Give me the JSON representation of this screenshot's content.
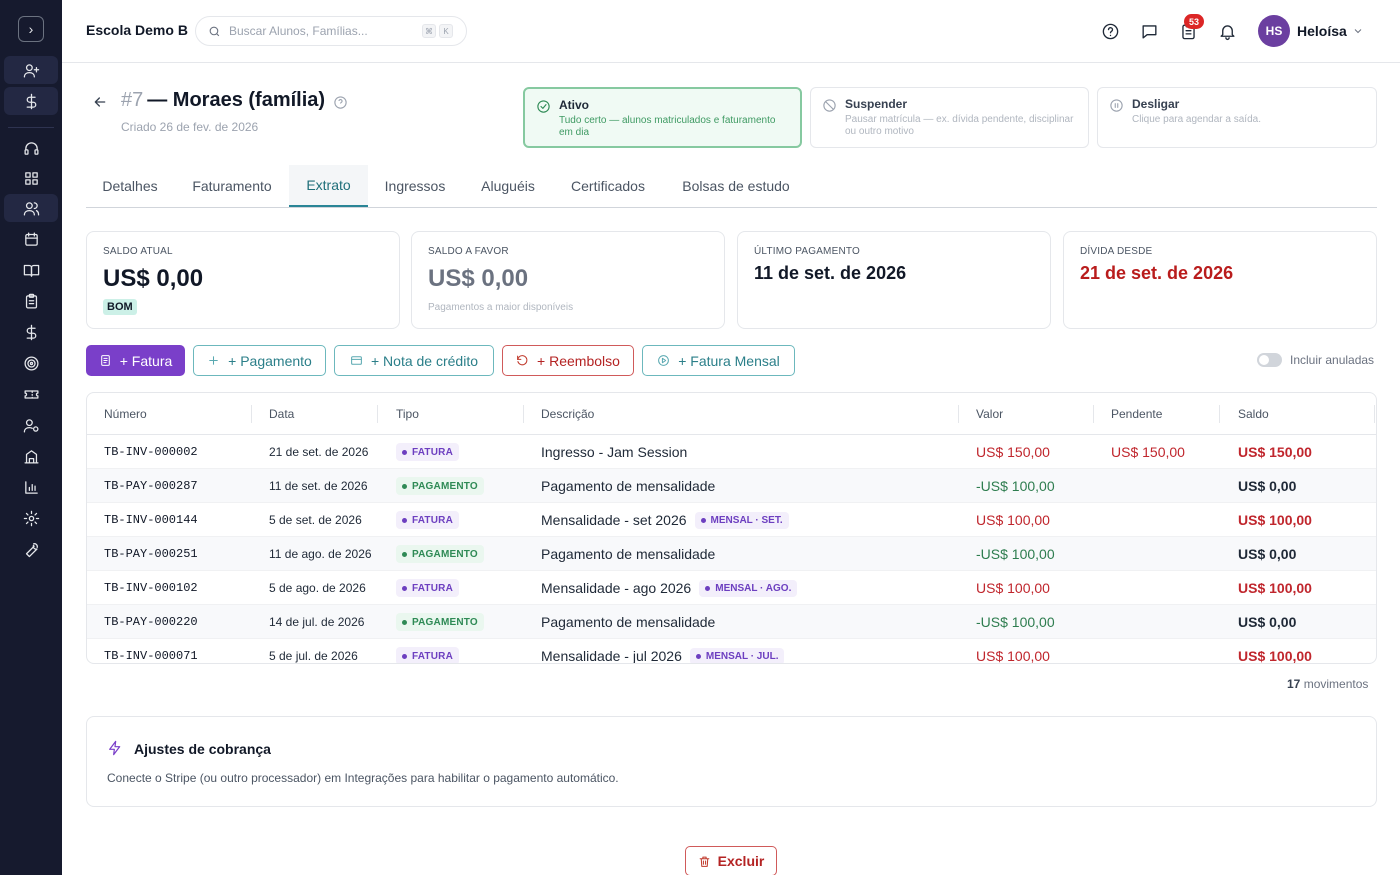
{
  "header": {
    "school": "Escola Demo B",
    "search_placeholder": "Buscar Alunos, Famílias...",
    "shortcut": [
      "⌘",
      "K"
    ],
    "notification_count": "53",
    "user_initials": "HS",
    "user_name": "Heloísa"
  },
  "page": {
    "id": "#7",
    "title": "— Moraes (família)",
    "created": "Criado 26 de fev. de 2026"
  },
  "status_cards": [
    {
      "title": "Ativo",
      "desc": "Tudo certo — alunos matriculados e faturamento em dia",
      "icon": "check-circle-icon"
    },
    {
      "title": "Suspender",
      "desc": "Pausar matrícula — ex. dívida pendente, disciplinar ou outro motivo",
      "icon": "ban-icon"
    },
    {
      "title": "Desligar",
      "desc": "Clique para agendar a saída.",
      "icon": "pause-circle-icon"
    }
  ],
  "tabs": [
    "Detalhes",
    "Faturamento",
    "Extrato",
    "Ingressos",
    "Aluguéis",
    "Certificados",
    "Bolsas de estudo"
  ],
  "active_tab": "Extrato",
  "summary": {
    "saldo_atual_label": "SALDO ATUAL",
    "saldo_atual": "US$ 0,00",
    "saldo_status": "BOM",
    "saldo_favor_label": "SALDO A FAVOR",
    "saldo_favor": "US$ 0,00",
    "saldo_favor_hint": "Pagamentos a maior disponíveis",
    "ultimo_pagamento_label": "ÚLTIMO PAGAMENTO",
    "ultimo_pagamento": "11 de set. de 2026",
    "divida_label": "DÍVIDA DESDE",
    "divida": "21 de set. de 2026"
  },
  "actions": {
    "fatura": "+ Fatura",
    "pagamento": "+ Pagamento",
    "nota_credito": "+ Nota de crédito",
    "reembolso": "+ Reembolso",
    "fatura_mensal": "+ Fatura Mensal",
    "incluir_anuladas": "Incluir anuladas"
  },
  "table": {
    "headers": [
      "Número",
      "Data",
      "Tipo",
      "Descrição",
      "Valor",
      "Pendente",
      "Saldo"
    ],
    "rows": [
      {
        "numero": "TB-INV-000002",
        "data": "21 de set. de 2026",
        "tipo": "FATURA",
        "descricao": "Ingresso - Jam Session",
        "tag": "",
        "valor": "US$ 150,00",
        "pendente": "US$ 150,00",
        "saldo": "US$ 150,00"
      },
      {
        "numero": "TB-PAY-000287",
        "data": "11 de set. de 2026",
        "tipo": "PAGAMENTO",
        "descricao": "Pagamento de mensalidade",
        "tag": "",
        "valor": "-US$ 100,00",
        "pendente": "",
        "saldo": "US$ 0,00"
      },
      {
        "numero": "TB-INV-000144",
        "data": "5 de set. de 2026",
        "tipo": "FATURA",
        "descricao": "Mensalidade - set 2026",
        "tag": "MENSAL · SET.",
        "valor": "US$ 100,00",
        "pendente": "",
        "saldo": "US$ 100,00"
      },
      {
        "numero": "TB-PAY-000251",
        "data": "11 de ago. de 2026",
        "tipo": "PAGAMENTO",
        "descricao": "Pagamento de mensalidade",
        "tag": "",
        "valor": "-US$ 100,00",
        "pendente": "",
        "saldo": "US$ 0,00"
      },
      {
        "numero": "TB-INV-000102",
        "data": "5 de ago. de 2026",
        "tipo": "FATURA",
        "descricao": "Mensalidade - ago 2026",
        "tag": "MENSAL · AGO.",
        "valor": "US$ 100,00",
        "pendente": "",
        "saldo": "US$ 100,00"
      },
      {
        "numero": "TB-PAY-000220",
        "data": "14 de jul. de 2026",
        "tipo": "PAGAMENTO",
        "descricao": "Pagamento de mensalidade",
        "tag": "",
        "valor": "-US$ 100,00",
        "pendente": "",
        "saldo": "US$ 0,00"
      },
      {
        "numero": "TB-INV-000071",
        "data": "5 de jul. de 2026",
        "tipo": "FATURA",
        "descricao": "Mensalidade - jul 2026",
        "tag": "MENSAL · JUL.",
        "valor": "US$ 100,00",
        "pendente": "",
        "saldo": "US$ 100,00"
      }
    ],
    "count": "17",
    "count_label": "movimentos"
  },
  "billing": {
    "title": "Ajustes de cobrança",
    "desc": "Conecte o Stripe (ou outro processador) em Integrações para habilitar o pagamento automático."
  },
  "delete_label": "Excluir",
  "colors": {
    "accent": "#7a3fc9",
    "teal": "#2a8596",
    "danger": "#c0262d",
    "success": "#2e7d4f",
    "sidebar": "#161a2e"
  }
}
